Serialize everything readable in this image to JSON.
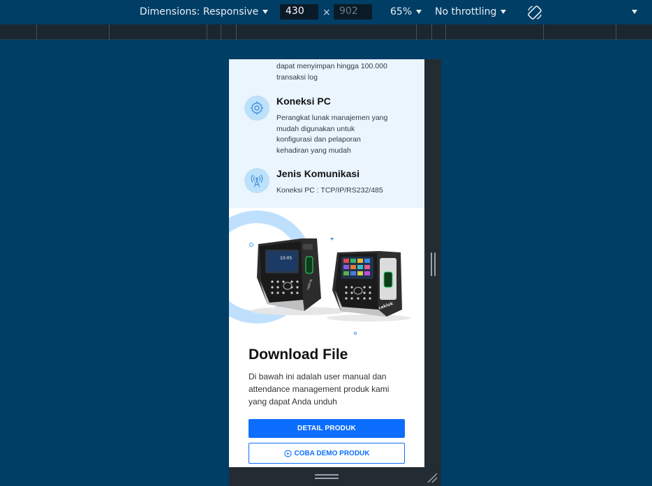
{
  "devtools": {
    "dimensions_label": "Dimensions: Responsive",
    "width_value": "430",
    "height_placeholder": "902",
    "times": "×",
    "zoom_label": "65%",
    "throttling_label": "No throttling"
  },
  "features": [
    {
      "icon": "database-icon",
      "title": "",
      "text_lines": [
        "dapat menyimpan hingga 100.000",
        "transaksi log"
      ]
    },
    {
      "icon": "gear-icon",
      "title": "Koneksi PC",
      "text_lines": [
        "Perangkat lunak manajemen yang",
        "mudah digunakan untuk",
        "konfigurasi dan pelaporan",
        "kehadiran yang mudah"
      ]
    },
    {
      "icon": "antenna-icon",
      "title": "Jenis Komunikasi",
      "text_lines": [
        "Koneksi PC : TCP/IP/RS232/485"
      ]
    }
  ],
  "hero": {
    "device_screen_time": "10:05",
    "brand_left": "cekl•k",
    "brand_right": "ceklok"
  },
  "download": {
    "title": "Download File",
    "description": "Di bawah ini adalah user manual dan attendance management produk kami yang dapat Anda unduh",
    "primary_button": "DETAIL PRODUK",
    "secondary_button": "COBA DEMO PRODUK"
  },
  "colors": {
    "devtools_bg": "#003e66",
    "accent": "#0d6efd",
    "feature_bg": "#eaf5fe",
    "icon_circle": "#bde0fb"
  }
}
